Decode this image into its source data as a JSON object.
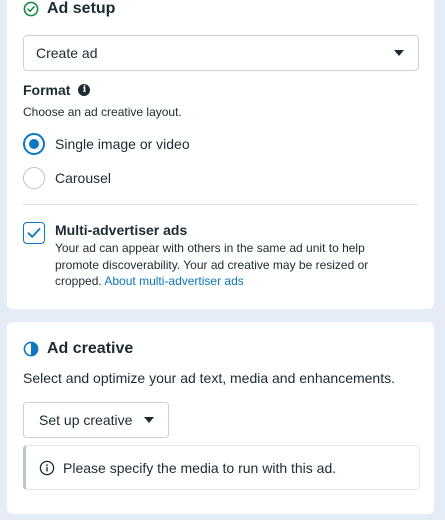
{
  "ad_setup": {
    "title": "Ad setup",
    "select_value": "Create ad",
    "format_label": "Format",
    "format_help": "Choose an ad creative layout.",
    "radio_options": [
      {
        "label": "Single image or video",
        "checked": true
      },
      {
        "label": "Carousel",
        "checked": false
      }
    ],
    "multi_advertiser": {
      "title": "Multi-advertiser ads",
      "checked": true,
      "description": "Your ad can appear with others in the same ad unit to help promote discoverability. Your ad creative may be resized or cropped.",
      "link_text": "About multi-advertiser ads"
    }
  },
  "ad_creative": {
    "title": "Ad creative",
    "description": "Select and optimize your ad text, media and enhancements.",
    "button_label": "Set up creative",
    "notice": "Please specify the media to run with this ad."
  },
  "colors": {
    "accent": "#0a78be",
    "text": "#1c2b33",
    "background": "#e6ecf6"
  },
  "icons": {
    "ad_setup": "check-circle-icon",
    "ad_creative": "half-circle-icon",
    "format_info": "info-icon",
    "notice": "info-icon"
  }
}
